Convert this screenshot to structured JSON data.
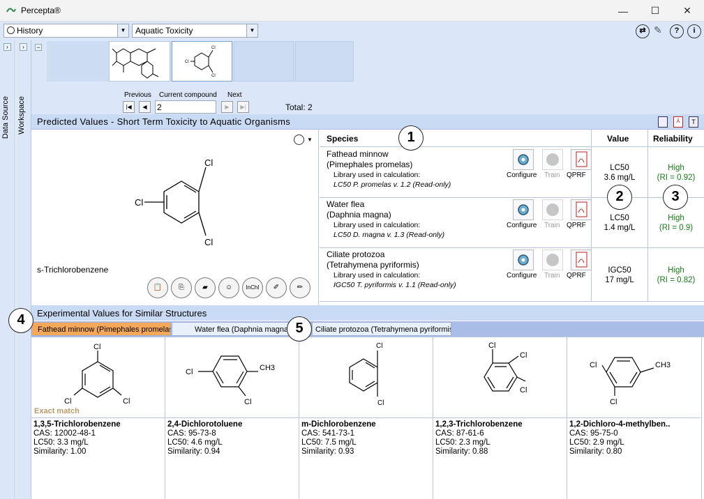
{
  "app": {
    "title": "Percepta®"
  },
  "window": {
    "minimize": "—",
    "maximize": "☐",
    "close": "✕"
  },
  "toolbar": {
    "history_label": "History",
    "endpoint": "Aquatic Toxicity",
    "icons": [
      "refresh-icon",
      "tools-icon",
      "help-icon",
      "info-icon"
    ]
  },
  "side_tabs": [
    "Data Source",
    "Workspace"
  ],
  "navigator": {
    "previous": "Previous",
    "current": "Current compound",
    "next": "Next",
    "current_value": "2",
    "total": "Total: 2"
  },
  "predicted": {
    "title": "Predicted Values - Short Term Toxicity to Aquatic Organisms",
    "compound_name": "s-Trichlorobenzene",
    "columns": {
      "species": "Species",
      "value": "Value",
      "reliability": "Reliability"
    },
    "rows": [
      {
        "species": "Fathead minnow",
        "latin": "(Pimephales promelas)",
        "lib_label": "Library used in calculation:",
        "library": "LC50 P. promelas v. 1.2 (Read-only)",
        "measure": "LC50",
        "value": "3.6 mg/L",
        "rel": "High",
        "ri": "(RI = 0.92)"
      },
      {
        "species": "Water flea",
        "latin": "(Daphnia magna)",
        "lib_label": "Library used in calculation:",
        "library": "LC50 D. magna v. 1.3 (Read-only)",
        "measure": "LC50",
        "value": "1.4 mg/L",
        "rel": "High",
        "ri": "(RI = 0.9)"
      },
      {
        "species": "Ciliate protozoa",
        "latin": "(Tetrahymena pyriformis)",
        "lib_label": "Library used in calculation:",
        "library": "IGC50 T. pyriformis v. 1.1 (Read-only)",
        "measure": "IGC50",
        "value": "17 mg/L",
        "rel": "High",
        "ri": "(RI = 0.82)"
      }
    ],
    "actions": {
      "configure": "Configure",
      "train": "Train",
      "qprf": "QPRF"
    },
    "tool_labels": {
      "inchi": "InChI"
    }
  },
  "badges": [
    "1",
    "2",
    "3",
    "4",
    "5"
  ],
  "experimental": {
    "title": "Experimental Values for Similar Structures",
    "tabs": [
      "Fathead minnow (Pimephales promelas)",
      "Water flea (Daphnia magna)",
      "Ciliate protozoa (Tetrahymena pyriformis)"
    ],
    "exact_match": "Exact match",
    "cards": [
      {
        "name": "1,3,5-Trichlorobenzene",
        "cas": "CAS: 12002-48-1",
        "lc50": "LC50: 3.3 mg/L",
        "sim": "Similarity:  1.00"
      },
      {
        "name": "2,4-Dichlorotoluene",
        "cas": "CAS: 95-73-8",
        "lc50": "LC50: 4.6 mg/L",
        "sim": "Similarity:  0.94"
      },
      {
        "name": "m-Dichlorobenzene",
        "cas": "CAS: 541-73-1",
        "lc50": "LC50: 7.5 mg/L",
        "sim": "Similarity:  0.93"
      },
      {
        "name": "1,2,3-Trichlorobenzene",
        "cas": "CAS: 87-61-6",
        "lc50": "LC50: 2.3 mg/L",
        "sim": "Similarity:  0.88"
      },
      {
        "name": "1,2-Dichloro-4-methylben..",
        "cas": "CAS: 95-75-0",
        "lc50": "LC50: 2.9 mg/L",
        "sim": "Similarity:  0.80"
      }
    ]
  },
  "atoms": {
    "cl": "Cl",
    "ch3": "CH3"
  }
}
